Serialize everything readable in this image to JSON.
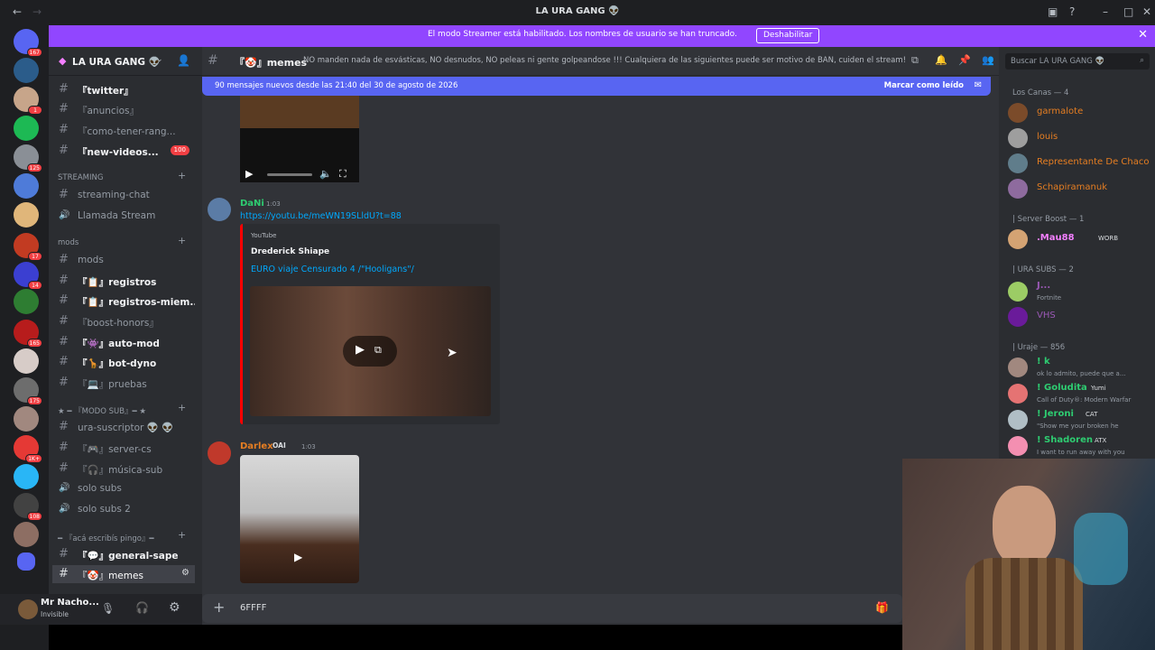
{
  "titlebar": {
    "title": "LA URA GANG 👽"
  },
  "banner": {
    "message": "El modo Streamer está habilitado. Los nombres de usuario se han truncado.",
    "button": "Deshabilitar"
  },
  "servers": {
    "badges": [
      "167",
      "1",
      "125",
      "17",
      "14",
      "165",
      "175",
      "1K+",
      "108"
    ]
  },
  "server": {
    "name": "LA URA GANG 👽"
  },
  "channels": [
    {
      "label": "『twitter』",
      "unread": true
    },
    {
      "label": "『anuncios』"
    },
    {
      "label": "『como-tener-rang..."
    },
    {
      "label": "『new-videos...",
      "unread": true,
      "count": "100"
    },
    {
      "label": "streaming-chat"
    },
    {
      "label": "Llamada Stream"
    },
    {
      "label": "mods"
    },
    {
      "label": "『📋』registros",
      "unread": true
    },
    {
      "label": "『📋』registros-miem...",
      "unread": true
    },
    {
      "label": "『boost-honors』"
    },
    {
      "label": "『👾』auto-mod",
      "unread": true
    },
    {
      "label": "『🦒』bot-dyno",
      "unread": true
    },
    {
      "label": "『💻』pruebas"
    },
    {
      "label": "ura-suscriptor 👽 👽"
    },
    {
      "label": "『🎮』server-cs"
    },
    {
      "label": "『🎧』música-sub"
    },
    {
      "label": "solo subs"
    },
    {
      "label": "solo subs 2"
    },
    {
      "label": "『💬』general-sape",
      "unread": true
    },
    {
      "label": "『🤡』memes",
      "selected": true
    }
  ],
  "categories": {
    "streaming": "STREAMING",
    "mods": "mods",
    "modo_sub": "★ ━ 『MODO SUB』━ ★",
    "aca": "━ 『acá escribís pingo』━"
  },
  "user": {
    "name": "Mr Nacho...",
    "status": "Invisible"
  },
  "channel_header": {
    "name": "『🤡』memes",
    "topic": "NO manden nada de esvásticas, NO desnudos, NO peleas ni gente golpeandose !!! Cualquiera de las siguientes puede ser motivo de BAN, cuiden el stream!"
  },
  "new_messages": {
    "text": "90 mensajes nuevos desde las 21:40 del 30 de agosto de 2026",
    "mark": "Marcar como leído"
  },
  "messages": [
    {
      "author": "DaNi",
      "time": "1:03",
      "link": "https://youtu.be/meWN19SLldU?t=88",
      "embed": {
        "provider": "YouTube",
        "author": "Drederick Shiape",
        "title": "EURO viaje Censurado 4 /\"Hooligans\"/"
      }
    },
    {
      "author": "Darlex",
      "tag": "OAI",
      "time": "1:03"
    }
  ],
  "composer": {
    "value": "6FFFF"
  },
  "members": {
    "search": "Buscar LA URA GANG 👽",
    "groups": [
      {
        "title": "Los Canas — 4",
        "items": [
          {
            "name": "garmalote"
          },
          {
            "name": "louis"
          },
          {
            "name": "Representante De Chaco"
          },
          {
            "name": "Schapiramanuk"
          }
        ]
      },
      {
        "title": "| Server Boost — 1",
        "items": [
          {
            "name": ".Mau88",
            "badge": "WORB"
          }
        ]
      },
      {
        "title": "| URA SUBS — 2",
        "items": [
          {
            "name": "J...",
            "status": "Fortnite"
          },
          {
            "name": "VHS"
          }
        ]
      },
      {
        "title": "| Uraje — 856",
        "items": [
          {
            "name": "! k",
            "status": "ok lo admito, puede que a..."
          },
          {
            "name": "! Goludita",
            "badge": "Yumi",
            "status": "Call of Duty®: Modern Warfar"
          },
          {
            "name": "! Jeroni",
            "badge": "CAT",
            "status": "\"Show me your broken he"
          },
          {
            "name": "! Shadoren",
            "badge": "ATX",
            "status": "I want to run away with you"
          }
        ]
      }
    ]
  },
  "colors": {
    "accent": "#5865f2",
    "streamer": "#9146ff",
    "youtube": "#ff0000",
    "mod": "#e67e22"
  }
}
